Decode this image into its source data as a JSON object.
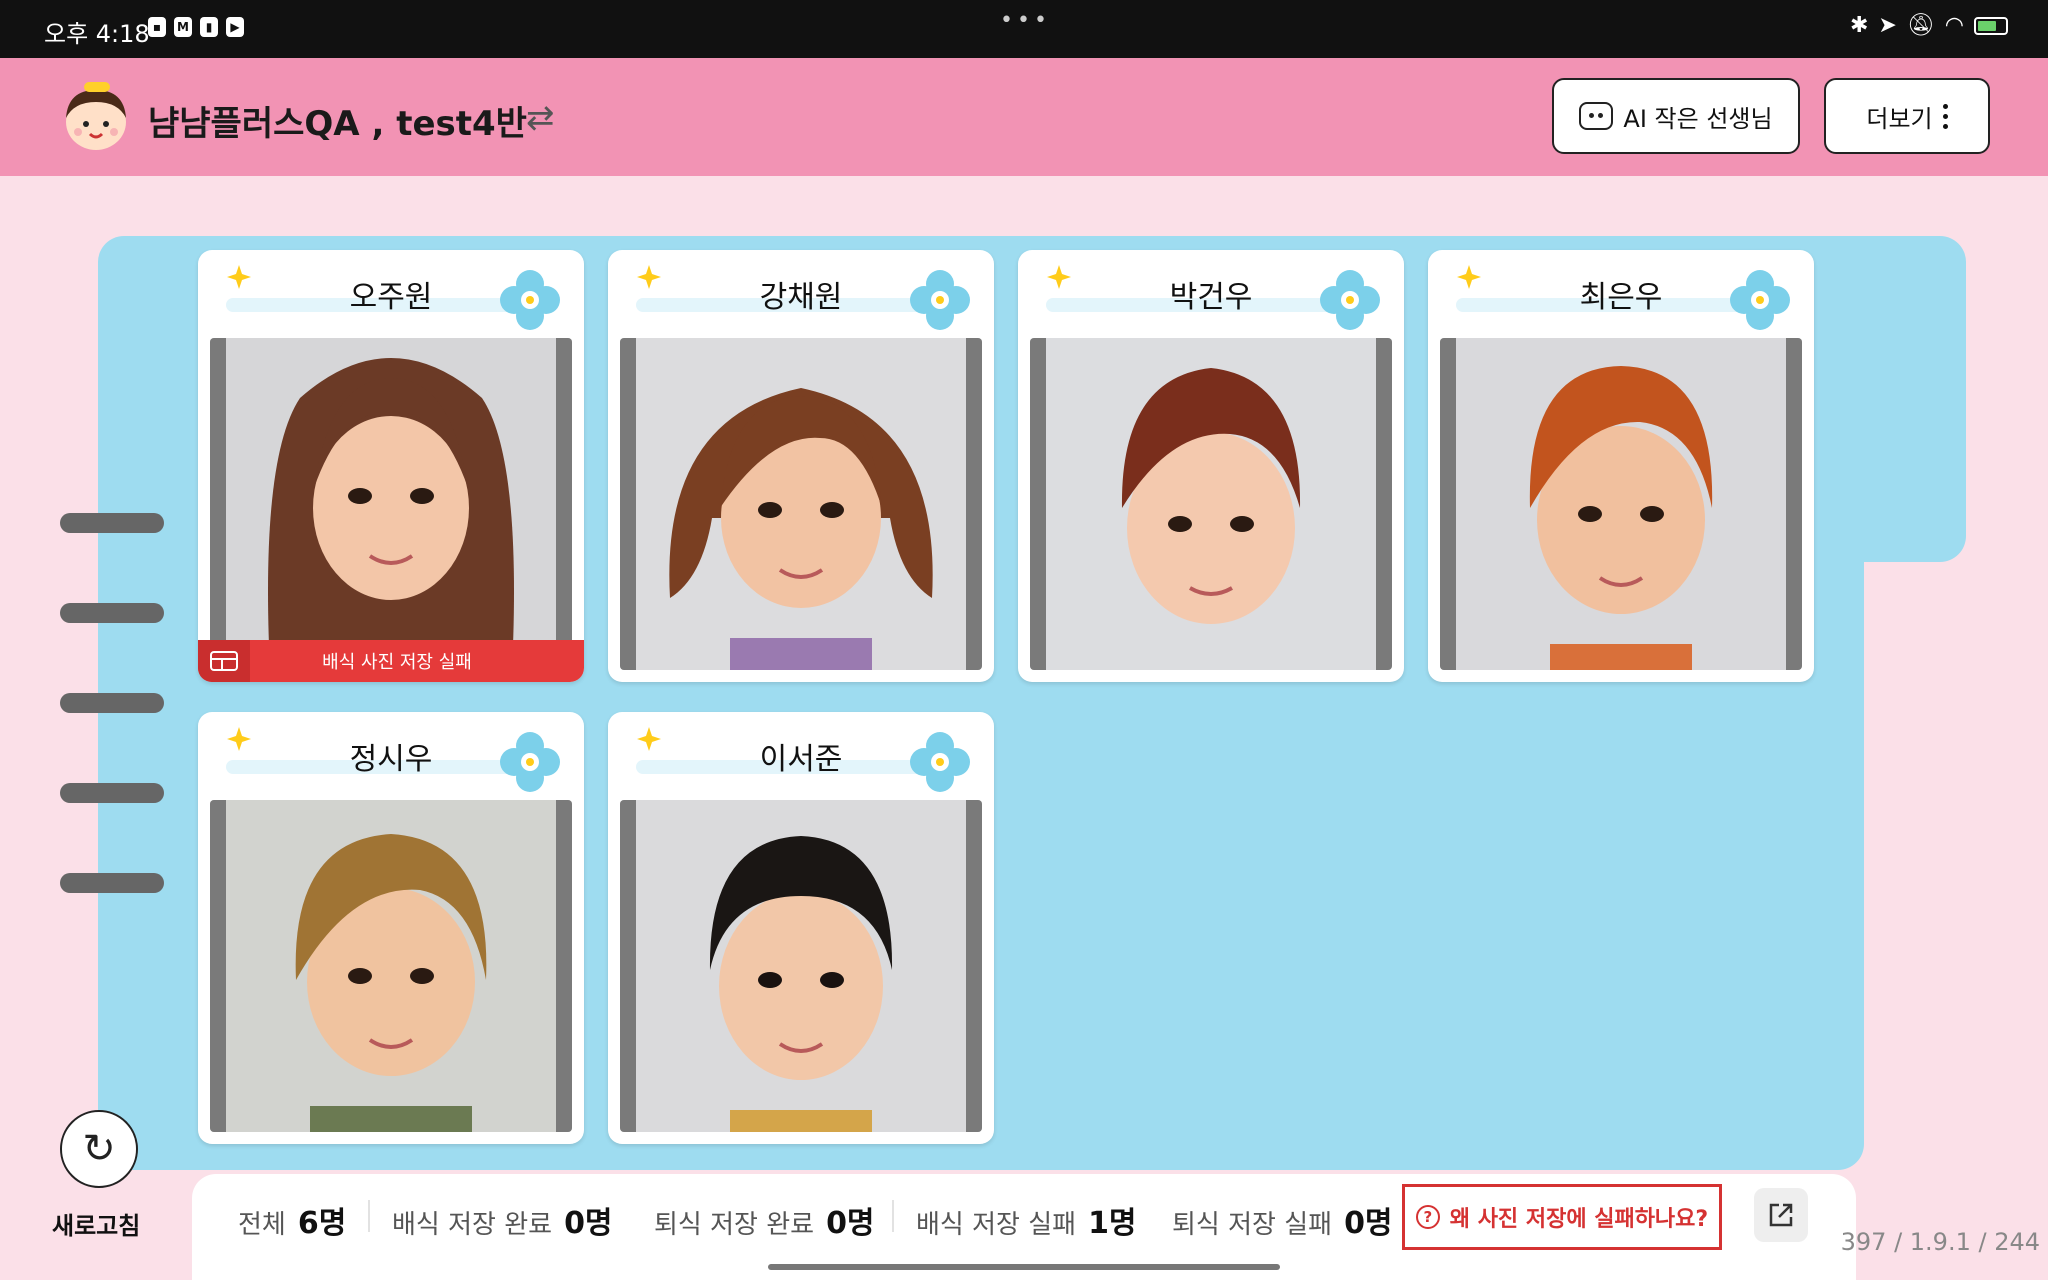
{
  "status_bar": {
    "time": "오후 4:18"
  },
  "header": {
    "class_title": "냠냠플러스QA , test4반",
    "ai_button_label": "AI 작은 선생님",
    "more_button_label": "더보기"
  },
  "students": [
    {
      "name": "오주원",
      "status_text": "배식 사진 저장 실패"
    },
    {
      "name": "강채원"
    },
    {
      "name": "박건우"
    },
    {
      "name": "최은우"
    },
    {
      "name": "정시우"
    },
    {
      "name": "이서준"
    }
  ],
  "refresh_label": "새로고침",
  "summary": {
    "total_label": "전체",
    "total_value": "6명",
    "meal_done_label": "배식 저장 완료",
    "meal_done_value": "0명",
    "leftover_done_label": "퇴식 저장 완료",
    "leftover_done_value": "0명",
    "meal_fail_label": "배식 저장 실패",
    "meal_fail_value": "1명",
    "leftover_fail_label": "퇴식 저장 실패",
    "leftover_fail_value": "0명",
    "why_button_label": "왜 사진 저장에 실패하나요?"
  },
  "version": "397 / 1.9.1 / 244",
  "colors": {
    "header_bg": "#f293b4",
    "board_bg": "#9edcf0",
    "page_bg": "#fbe0e8",
    "fail_red": "#e53a3a"
  }
}
